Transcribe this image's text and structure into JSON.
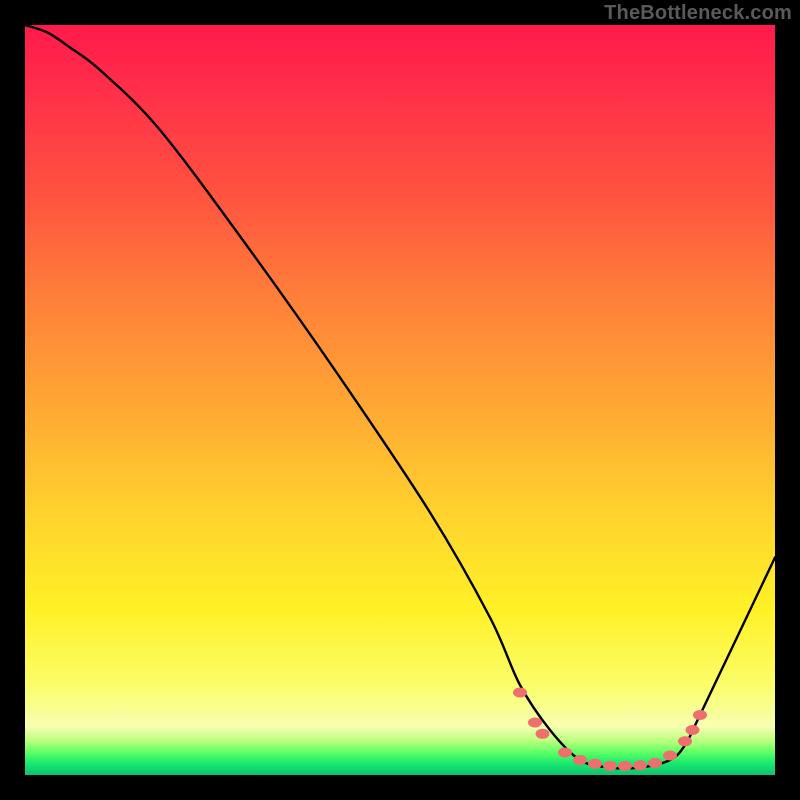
{
  "watermark": {
    "text": "TheBottleneck.com"
  },
  "chart_data": {
    "type": "line",
    "title": "",
    "xlabel": "",
    "ylabel": "",
    "xlim": [
      0,
      100
    ],
    "ylim": [
      0,
      100
    ],
    "series": [
      {
        "name": "bottleneck-curve",
        "x": [
          0,
          3,
          6,
          10,
          18,
          30,
          42,
          54,
          62,
          66,
          70,
          74,
          78,
          82,
          86,
          88,
          90,
          100
        ],
        "y": [
          100,
          99,
          97,
          94,
          86,
          70,
          53,
          35,
          21,
          12,
          6,
          2,
          1,
          1,
          2,
          4,
          8,
          29
        ]
      }
    ],
    "markers": {
      "name": "optimal-range-dots",
      "color": "#ef6e6e",
      "points": [
        {
          "x": 66,
          "y": 11
        },
        {
          "x": 68,
          "y": 7
        },
        {
          "x": 69,
          "y": 5.5
        },
        {
          "x": 72,
          "y": 3
        },
        {
          "x": 74,
          "y": 2
        },
        {
          "x": 76,
          "y": 1.5
        },
        {
          "x": 78,
          "y": 1.2
        },
        {
          "x": 80,
          "y": 1.2
        },
        {
          "x": 82,
          "y": 1.3
        },
        {
          "x": 84,
          "y": 1.6
        },
        {
          "x": 86,
          "y": 2.6
        },
        {
          "x": 88,
          "y": 4.5
        },
        {
          "x": 89,
          "y": 6
        },
        {
          "x": 90,
          "y": 8
        }
      ]
    },
    "gradient_stops": [
      {
        "pos": 0,
        "color": "#ff1a4b"
      },
      {
        "pos": 0.22,
        "color": "#ff5140"
      },
      {
        "pos": 0.52,
        "color": "#ffab33"
      },
      {
        "pos": 0.78,
        "color": "#fff127"
      },
      {
        "pos": 0.94,
        "color": "#f7ffb0"
      },
      {
        "pos": 0.97,
        "color": "#5cff64"
      },
      {
        "pos": 1.0,
        "color": "#0fc071"
      }
    ]
  }
}
